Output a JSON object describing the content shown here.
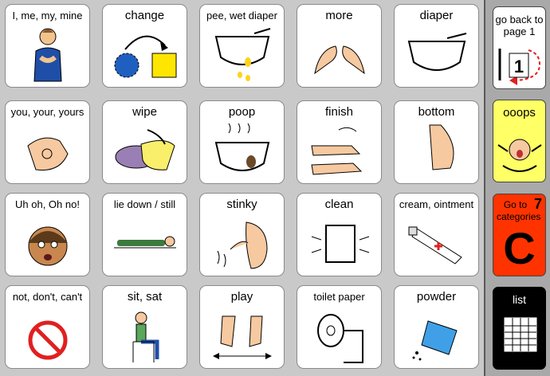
{
  "grid": {
    "cells": [
      {
        "label": "I, me, my, mine"
      },
      {
        "label": "change"
      },
      {
        "label": "pee,  wet diaper"
      },
      {
        "label": "more"
      },
      {
        "label": "diaper"
      },
      {
        "label": "you, your, yours"
      },
      {
        "label": "wipe"
      },
      {
        "label": "poop"
      },
      {
        "label": "finish"
      },
      {
        "label": "bottom"
      },
      {
        "label": "Uh oh,  Oh no!"
      },
      {
        "label": "lie down / still"
      },
      {
        "label": "stinky"
      },
      {
        "label": "clean"
      },
      {
        "label": "cream, ointment"
      },
      {
        "label": "not, don't, can't"
      },
      {
        "label": "sit, sat"
      },
      {
        "label": "play"
      },
      {
        "label": "toilet paper"
      },
      {
        "label": "powder"
      }
    ]
  },
  "sidebar": {
    "back": {
      "label": "go back to page 1",
      "page_number": "1"
    },
    "ooops": {
      "label": "ooops"
    },
    "categories": {
      "label": "Go to categories",
      "number": "7",
      "letter": "C"
    },
    "list": {
      "label": "list"
    }
  },
  "colors": {
    "background": "#c9c9c9",
    "cell": "#ffffff",
    "ooops_bg": "#ffff66",
    "categories_bg": "#ff3300",
    "list_bg": "#000000"
  }
}
